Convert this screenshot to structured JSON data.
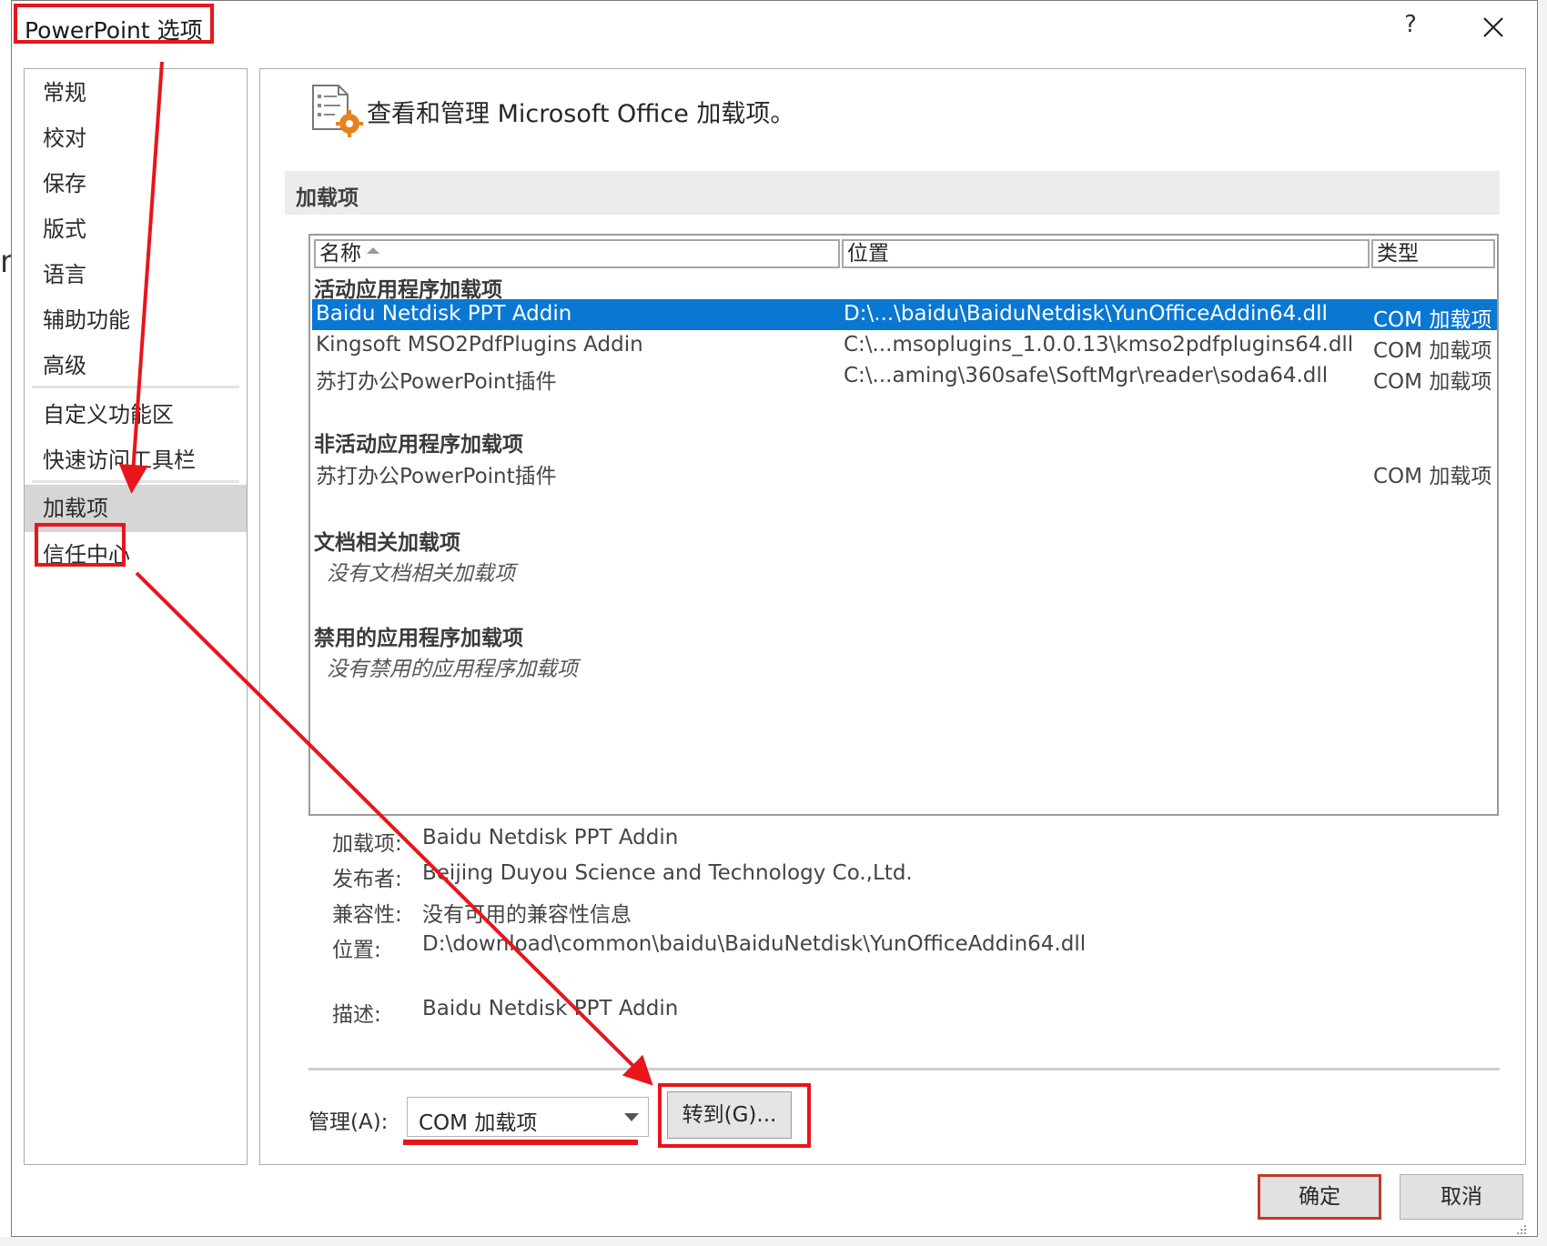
{
  "window": {
    "title": "PowerPoint 选项",
    "help_label": "?",
    "close_label": "✕",
    "edge_mark": "n"
  },
  "nav": {
    "items": [
      {
        "label": "常规"
      },
      {
        "label": "校对"
      },
      {
        "label": "保存"
      },
      {
        "label": "版式"
      },
      {
        "label": "语言"
      },
      {
        "label": "辅助功能"
      },
      {
        "label": "高级"
      },
      {
        "label": "自定义功能区"
      },
      {
        "label": "快速访问工具栏"
      },
      {
        "label": "加载项",
        "selected": true
      },
      {
        "label": "信任中心"
      }
    ]
  },
  "main": {
    "icon": "addins-settings-icon",
    "heading": "查看和管理 Microsoft Office 加载项。",
    "section_title": "加载项",
    "columns": [
      "名称",
      "位置",
      "类型"
    ],
    "groups": {
      "active": {
        "title": "活动应用程序加载项",
        "rows": [
          {
            "name": "Baidu Netdisk PPT Addin",
            "location": "D:\\...\\baidu\\BaiduNetdisk\\YunOfficeAddin64.dll",
            "type": "COM 加载项",
            "selected": true
          },
          {
            "name": "Kingsoft MSO2PdfPlugins Addin",
            "location": "C:\\...msoplugins_1.0.0.13\\kmso2pdfplugins64.dll",
            "type": "COM 加载项"
          },
          {
            "name": "苏打办公PowerPoint插件",
            "location": "C:\\...aming\\360safe\\SoftMgr\\reader\\soda64.dll",
            "type": "COM 加载项"
          }
        ]
      },
      "inactive": {
        "title": "非活动应用程序加载项",
        "rows": [
          {
            "name": "苏打办公PowerPoint插件",
            "location": "",
            "type": "COM 加载项"
          }
        ]
      },
      "document": {
        "title": "文档相关加载项",
        "empty": "没有文档相关加载项"
      },
      "disabled": {
        "title": "禁用的应用程序加载项",
        "empty": "没有禁用的应用程序加载项"
      }
    },
    "details": {
      "addin_label": "加载项:",
      "addin_value": "Baidu Netdisk PPT Addin",
      "publisher_label": "发布者:",
      "publisher_value": "Beijing Duyou Science and Technology Co.,Ltd.",
      "compat_label": "兼容性:",
      "compat_value": "没有可用的兼容性信息",
      "location_label": "位置:",
      "location_value": "D:\\download\\common\\baidu\\BaiduNetdisk\\YunOfficeAddin64.dll",
      "desc_label": "描述:",
      "desc_value": "Baidu Netdisk PPT Addin"
    },
    "manage": {
      "label": "管理(A):",
      "selected": "COM 加载项",
      "goto_label": "转到(G)..."
    }
  },
  "footer": {
    "ok_label": "确定",
    "cancel_label": "取消"
  },
  "annotation_color": "#e8151c",
  "selection_color": "#0a77d3"
}
